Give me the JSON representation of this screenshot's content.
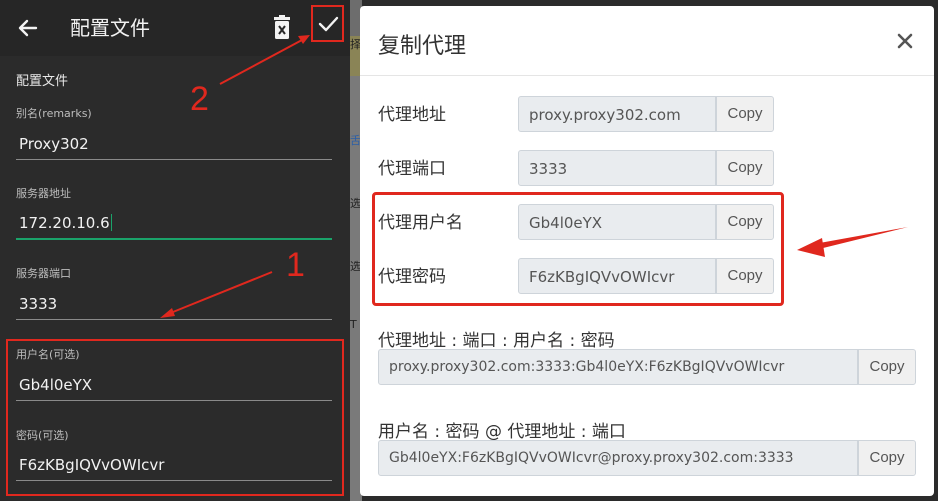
{
  "app": {
    "title": "配置文件",
    "section_title": "配置文件"
  },
  "form": {
    "remarks": {
      "label": "别名(remarks)",
      "value": "Proxy302"
    },
    "server": {
      "label": "服务器地址",
      "value": "172.20.10.6"
    },
    "port": {
      "label": "服务器端口",
      "value": "3333"
    },
    "username": {
      "label": "用户名(可选)",
      "value": "Gb4l0eYX"
    },
    "password": {
      "label": "密码(可选)",
      "value": "F6zKBgIQVvOWIcvr"
    }
  },
  "annotations": {
    "step1": "1",
    "step2": "2",
    "color": "#e0281e"
  },
  "background_strip": [
    "择",
    "舌",
    "选",
    "选",
    "T"
  ],
  "dialog": {
    "title": "复制代理",
    "close_symbol": "×",
    "rows": [
      {
        "label": "代理地址",
        "value": "proxy.proxy302.com",
        "button": "Copy"
      },
      {
        "label": "代理端口",
        "value": "3333",
        "button": "Copy"
      },
      {
        "label": "代理用户名",
        "value": "Gb4l0eYX",
        "button": "Copy"
      },
      {
        "label": "代理密码",
        "value": "F6zKBgIQVvOWIcvr",
        "button": "Copy"
      }
    ],
    "combo1": {
      "label": "代理地址 : 端口 : 用户名 : 密码",
      "value": "proxy.proxy302.com:3333:Gb4l0eYX:F6zKBgIQVvOWIcvr",
      "button": "Copy"
    },
    "combo2": {
      "label": "用户名 : 密码 @ 代理地址 : 端口",
      "value": "Gb4l0eYX:F6zKBgIQVvOWIcvr@proxy.proxy302.com:3333",
      "button": "Copy"
    }
  },
  "colors": {
    "accent_green": "#1aa36a",
    "dark_bg": "#2b2b2b",
    "dialog_bg": "#ffffff"
  }
}
